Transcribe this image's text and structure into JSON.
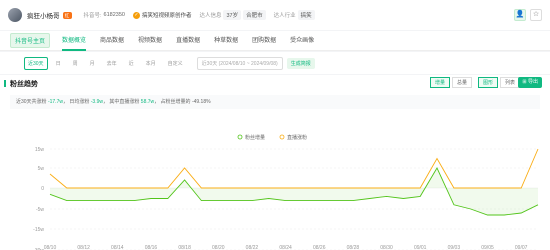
{
  "profile": {
    "name": "疯狂小杨哥",
    "badge": "红",
    "id_label": "抖音号:",
    "id_value": "6182350",
    "verified": "搞笑短视频原创作者",
    "info_label": "达人信息",
    "info_age": "37岁",
    "info_city": "合肥市",
    "industry_label": "达人行业",
    "industry_value": "搞笑"
  },
  "tabs": {
    "home": "抖音号主页",
    "items": [
      "数据概览",
      "商品数据",
      "视频数据",
      "直播数据",
      "种草数据",
      "团购数据",
      "受众画像"
    ]
  },
  "period": {
    "items": [
      "近30天",
      "日",
      "周",
      "月",
      "去年",
      "近",
      "本月",
      "自定义"
    ],
    "date_range": "近30天 (2024/08/10 ~ 2024/09/08)",
    "report": "生成简报"
  },
  "section": {
    "title": "粉丝趋势",
    "toggle1": [
      "增量",
      "总量"
    ],
    "toggle2": [
      "图形",
      "列表"
    ],
    "export": "导出"
  },
  "summary": {
    "prefix": "近30天共涨粉",
    "total": "-17.7w",
    "daily_prefix": "日均涨粉",
    "daily": "-3.9w",
    "live_prefix": "其中直播涨粉",
    "live": "58.7w",
    "pct_prefix": "占粉丝增量的",
    "pct": "-49.18%"
  },
  "chart_data": {
    "type": "line",
    "x": [
      "08/10",
      "08/11",
      "08/12",
      "08/13",
      "08/14",
      "08/15",
      "08/16",
      "08/17",
      "08/18",
      "08/19",
      "08/20",
      "08/21",
      "08/22",
      "08/23",
      "08/24",
      "08/25",
      "08/26",
      "08/27",
      "08/28",
      "08/29",
      "08/30",
      "08/31",
      "09/01",
      "09/02",
      "09/03",
      "09/04",
      "09/05",
      "09/06",
      "09/07",
      "09/08"
    ],
    "tick_labels": [
      "08/10",
      "08/12",
      "08/14",
      "08/16",
      "08/18",
      "08/20",
      "08/22",
      "08/24",
      "08/26",
      "08/28",
      "08/30",
      "09/01",
      "09/03",
      "09/05",
      "09/07"
    ],
    "yticks": [
      "15w",
      "5w",
      "0",
      "-5w",
      "-15w",
      "-30w"
    ],
    "ytick_values": [
      15,
      5,
      0,
      -5,
      -15,
      -30
    ],
    "series": [
      {
        "name": "粉丝增量",
        "color": "#52c41a",
        "values": [
          -1.5,
          -3,
          -3,
          -3,
          -3,
          -3,
          -2.5,
          -2.5,
          2,
          -3,
          -3,
          -3,
          -3,
          -2.5,
          -3,
          -3,
          -3,
          -3,
          -3,
          -2.5,
          -2,
          -2.5,
          -2,
          5,
          -4,
          -5,
          -8,
          -8,
          -7,
          -4
        ]
      },
      {
        "name": "直播涨粉",
        "color": "#faad14",
        "values": [
          3.5,
          0,
          0,
          0,
          0,
          0,
          0,
          0,
          5,
          0,
          0,
          0,
          0,
          0,
          0,
          0,
          0,
          0,
          0,
          0,
          0,
          0,
          0,
          10,
          0,
          0,
          0,
          0,
          0,
          23
        ]
      }
    ]
  }
}
